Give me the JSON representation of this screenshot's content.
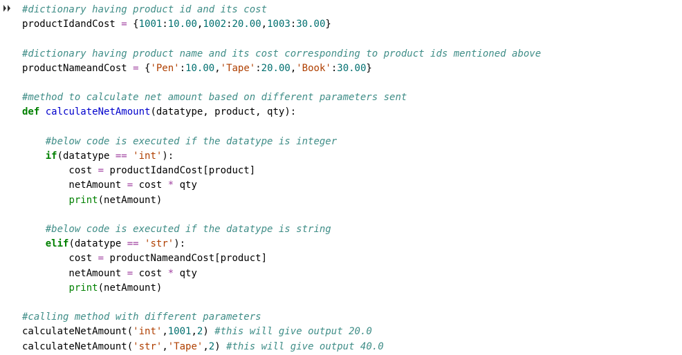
{
  "gutter": {
    "icon": "run-cell"
  },
  "code": {
    "lines": [
      [
        {
          "t": "#dictionary having product id and its cost",
          "c": "c"
        }
      ],
      [
        {
          "t": "productIdandCost ",
          "c": "nm"
        },
        {
          "t": "=",
          "c": "op"
        },
        {
          "t": " {",
          "c": "nm"
        },
        {
          "t": "1001",
          "c": "num"
        },
        {
          "t": ":",
          "c": "nm"
        },
        {
          "t": "10.00",
          "c": "num"
        },
        {
          "t": ",",
          "c": "nm"
        },
        {
          "t": "1002",
          "c": "num"
        },
        {
          "t": ":",
          "c": "nm"
        },
        {
          "t": "20.00",
          "c": "num"
        },
        {
          "t": ",",
          "c": "nm"
        },
        {
          "t": "1003",
          "c": "num"
        },
        {
          "t": ":",
          "c": "nm"
        },
        {
          "t": "30.00",
          "c": "num"
        },
        {
          "t": "}",
          "c": "nm"
        }
      ],
      [],
      [
        {
          "t": "#dictionary having product name and its cost corresponding to product ids mentioned above",
          "c": "c"
        }
      ],
      [
        {
          "t": "productNameandCost ",
          "c": "nm"
        },
        {
          "t": "=",
          "c": "op"
        },
        {
          "t": " {",
          "c": "nm"
        },
        {
          "t": "'Pen'",
          "c": "str"
        },
        {
          "t": ":",
          "c": "nm"
        },
        {
          "t": "10.00",
          "c": "num"
        },
        {
          "t": ",",
          "c": "nm"
        },
        {
          "t": "'Tape'",
          "c": "str"
        },
        {
          "t": ":",
          "c": "nm"
        },
        {
          "t": "20.00",
          "c": "num"
        },
        {
          "t": ",",
          "c": "nm"
        },
        {
          "t": "'Book'",
          "c": "str"
        },
        {
          "t": ":",
          "c": "nm"
        },
        {
          "t": "30.00",
          "c": "num"
        },
        {
          "t": "}",
          "c": "nm"
        }
      ],
      [],
      [
        {
          "t": "#method to calculate net amount based on different parameters sent",
          "c": "c"
        }
      ],
      [
        {
          "t": "def",
          "c": "kw"
        },
        {
          "t": " ",
          "c": "nm"
        },
        {
          "t": "calculateNetAmount",
          "c": "fn"
        },
        {
          "t": "(datatype, product, qty):",
          "c": "nm"
        }
      ],
      [],
      [
        {
          "t": "    ",
          "c": "nm"
        },
        {
          "t": "#below code is executed if the datatype is integer",
          "c": "c"
        }
      ],
      [
        {
          "t": "    ",
          "c": "nm"
        },
        {
          "t": "if",
          "c": "kw"
        },
        {
          "t": "(datatype ",
          "c": "nm"
        },
        {
          "t": "==",
          "c": "op"
        },
        {
          "t": " ",
          "c": "nm"
        },
        {
          "t": "'int'",
          "c": "str"
        },
        {
          "t": "):",
          "c": "nm"
        }
      ],
      [
        {
          "t": "        cost ",
          "c": "nm"
        },
        {
          "t": "=",
          "c": "op"
        },
        {
          "t": " productIdandCost[product]",
          "c": "nm"
        }
      ],
      [
        {
          "t": "        netAmount ",
          "c": "nm"
        },
        {
          "t": "=",
          "c": "op"
        },
        {
          "t": " cost ",
          "c": "nm"
        },
        {
          "t": "*",
          "c": "op"
        },
        {
          "t": " qty",
          "c": "nm"
        }
      ],
      [
        {
          "t": "        ",
          "c": "nm"
        },
        {
          "t": "print",
          "c": "bi"
        },
        {
          "t": "(netAmount)",
          "c": "nm"
        }
      ],
      [],
      [
        {
          "t": "    ",
          "c": "nm"
        },
        {
          "t": "#below code is executed if the datatype is string",
          "c": "c"
        }
      ],
      [
        {
          "t": "    ",
          "c": "nm"
        },
        {
          "t": "elif",
          "c": "kw"
        },
        {
          "t": "(datatype ",
          "c": "nm"
        },
        {
          "t": "==",
          "c": "op"
        },
        {
          "t": " ",
          "c": "nm"
        },
        {
          "t": "'str'",
          "c": "str"
        },
        {
          "t": "):",
          "c": "nm"
        }
      ],
      [
        {
          "t": "        cost ",
          "c": "nm"
        },
        {
          "t": "=",
          "c": "op"
        },
        {
          "t": " productNameandCost[product]",
          "c": "nm"
        }
      ],
      [
        {
          "t": "        netAmount ",
          "c": "nm"
        },
        {
          "t": "=",
          "c": "op"
        },
        {
          "t": " cost ",
          "c": "nm"
        },
        {
          "t": "*",
          "c": "op"
        },
        {
          "t": " qty",
          "c": "nm"
        }
      ],
      [
        {
          "t": "        ",
          "c": "nm"
        },
        {
          "t": "print",
          "c": "bi"
        },
        {
          "t": "(netAmount)",
          "c": "nm"
        }
      ],
      [],
      [
        {
          "t": "#calling method with different parameters",
          "c": "c"
        }
      ],
      [
        {
          "t": "calculateNetAmount(",
          "c": "nm"
        },
        {
          "t": "'int'",
          "c": "str"
        },
        {
          "t": ",",
          "c": "nm"
        },
        {
          "t": "1001",
          "c": "num"
        },
        {
          "t": ",",
          "c": "nm"
        },
        {
          "t": "2",
          "c": "num"
        },
        {
          "t": ") ",
          "c": "nm"
        },
        {
          "t": "#this will give output 20.0",
          "c": "c"
        }
      ],
      [
        {
          "t": "calculateNetAmount(",
          "c": "nm"
        },
        {
          "t": "'str'",
          "c": "str"
        },
        {
          "t": ",",
          "c": "nm"
        },
        {
          "t": "'Tape'",
          "c": "str"
        },
        {
          "t": ",",
          "c": "nm"
        },
        {
          "t": "2",
          "c": "num"
        },
        {
          "t": ") ",
          "c": "nm"
        },
        {
          "t": "#this will give output 40.0",
          "c": "c"
        }
      ]
    ]
  }
}
